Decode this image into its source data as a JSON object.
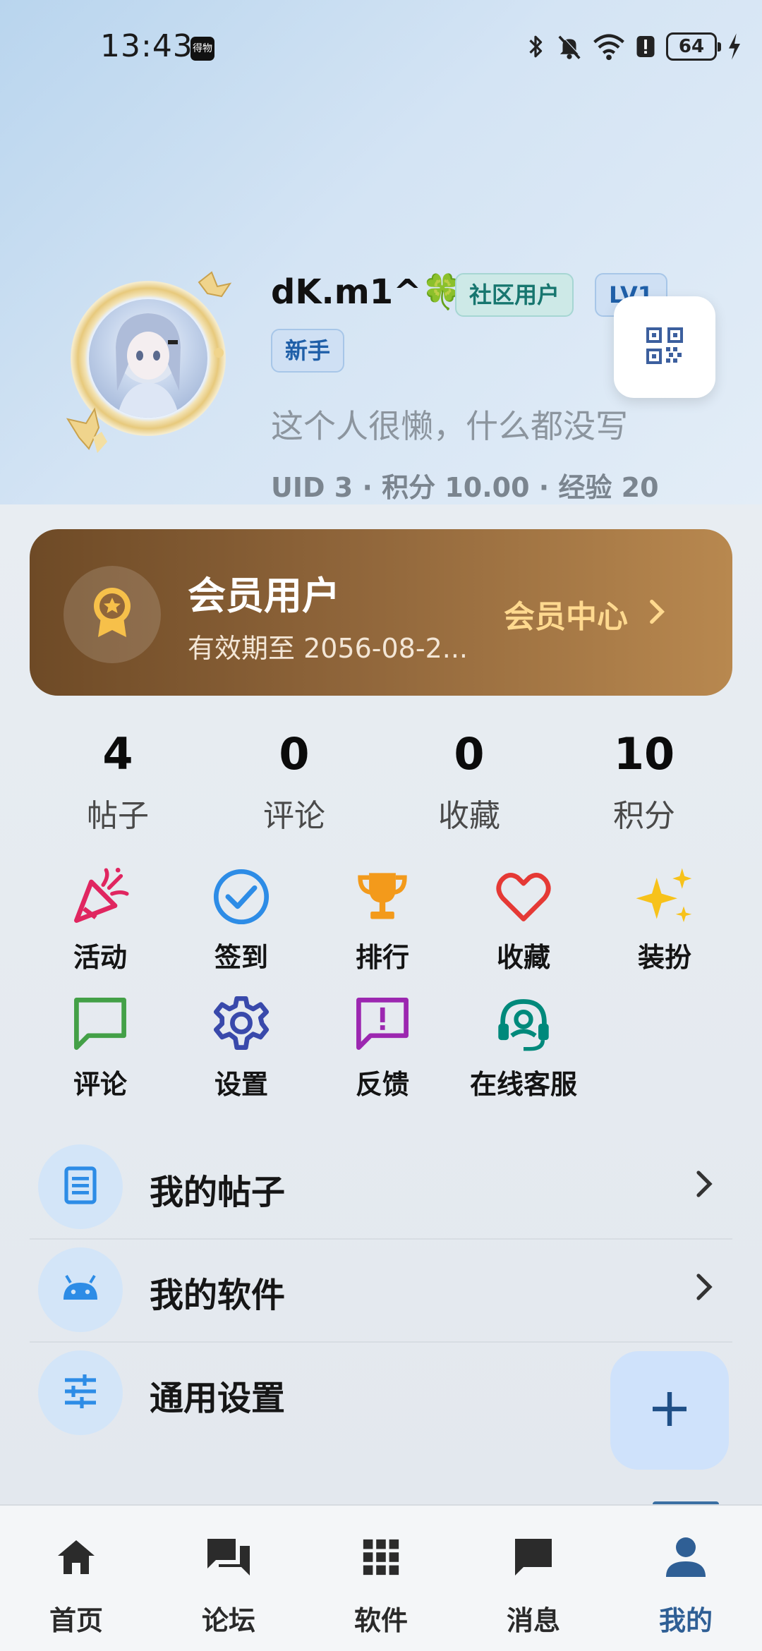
{
  "status_bar": {
    "time": "13:43",
    "app_icon_text": "得物",
    "battery": "64"
  },
  "profile": {
    "username": "dK.m1^🍀",
    "badges": {
      "community": "社区用户",
      "level": "LV1",
      "newbie": "新手"
    },
    "bio": "这个人很懒，什么都没写",
    "stats_line": "UID 3 · 积分 10.00 · 经验 20"
  },
  "vip": {
    "title": "会员用户",
    "expiry": "有效期至 2056-08-2...",
    "center_label": "会员中心"
  },
  "counters": [
    {
      "value": "4",
      "label": "帖子"
    },
    {
      "value": "0",
      "label": "评论"
    },
    {
      "value": "0",
      "label": "收藏"
    },
    {
      "value": "10",
      "label": "积分"
    }
  ],
  "grid": [
    {
      "label": "活动",
      "icon": "party-popper-icon",
      "color": "#e02660"
    },
    {
      "label": "签到",
      "icon": "check-circle-icon",
      "color": "#2d8ce6"
    },
    {
      "label": "排行",
      "icon": "trophy-icon",
      "color": "#f39a1b"
    },
    {
      "label": "收藏",
      "icon": "heart-icon",
      "color": "#e53935"
    },
    {
      "label": "装扮",
      "icon": "sparkles-icon",
      "color": "#f7c21a"
    },
    {
      "label": "评论",
      "icon": "comment-icon",
      "color": "#43a047"
    },
    {
      "label": "设置",
      "icon": "gear-icon",
      "color": "#3949ab"
    },
    {
      "label": "反馈",
      "icon": "feedback-icon",
      "color": "#9c27b0"
    },
    {
      "label": "在线客服",
      "icon": "headset-icon",
      "color": "#00897b"
    }
  ],
  "list": [
    {
      "label": "我的帖子",
      "icon": "document-icon"
    },
    {
      "label": "我的软件",
      "icon": "android-icon"
    },
    {
      "label": "通用设置",
      "icon": "sliders-icon"
    }
  ],
  "nav": [
    {
      "label": "首页",
      "icon": "home-icon"
    },
    {
      "label": "论坛",
      "icon": "forum-icon"
    },
    {
      "label": "软件",
      "icon": "apps-grid-icon"
    },
    {
      "label": "消息",
      "icon": "message-icon"
    },
    {
      "label": "我的",
      "icon": "person-icon",
      "active": true
    }
  ],
  "colors": {
    "accent": "#3a6fa3",
    "vip_gold": "#ffd98f",
    "vip_brown": "#6e4a26"
  }
}
